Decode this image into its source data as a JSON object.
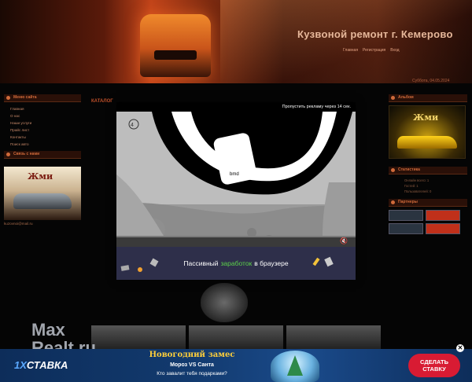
{
  "header": {
    "site_title": "Кузвоной ремонт г. Кемерово",
    "nav": [
      "Главная",
      "Регистрация",
      "Вход"
    ],
    "date": "Суббота, 04.05.2024"
  },
  "left": {
    "menu_title": "Меню сайта",
    "menu_items": [
      "Главная",
      "О нас",
      "Наши услуги",
      "Прайс лист",
      "Контакты",
      "Поиск авто"
    ],
    "links_title": "Связь с нами",
    "ad_text": "Жми",
    "email": "kuzovnoi@mail.ru"
  },
  "center": {
    "title": "КАТАЛОГ"
  },
  "right": {
    "album_title": "Альбом",
    "album_text": "Жми",
    "stats_title": "Статистика",
    "stats_lines": [
      "Онлайн всего: 1",
      "Гостей: 1",
      "Пользователей: 0"
    ],
    "partners_title": "Партнеры"
  },
  "overlay": {
    "skip_text": "Пропустить рекламу через 14 сек.",
    "screen_label": "bmd",
    "banner_before": "Пассивный",
    "banner_highlight": "заработок",
    "banner_after": "в браузере"
  },
  "watermark": {
    "line1": "Max",
    "line2": "Realt.ru"
  },
  "bottom_ad": {
    "brand_prefix": "1X",
    "brand_name": "СТАВКА",
    "promo_title": "Новогодний замес",
    "promo_sub1": "Мороз VS Санта",
    "promo_sub2": "Кто завалит тебя подарками?",
    "cta": "СДЕЛАТЬ СТАВКУ",
    "close": "✕"
  },
  "colors": {
    "accent": "#d06a3a",
    "banner_green": "#5cd04a",
    "cta_red": "#d81b33"
  }
}
